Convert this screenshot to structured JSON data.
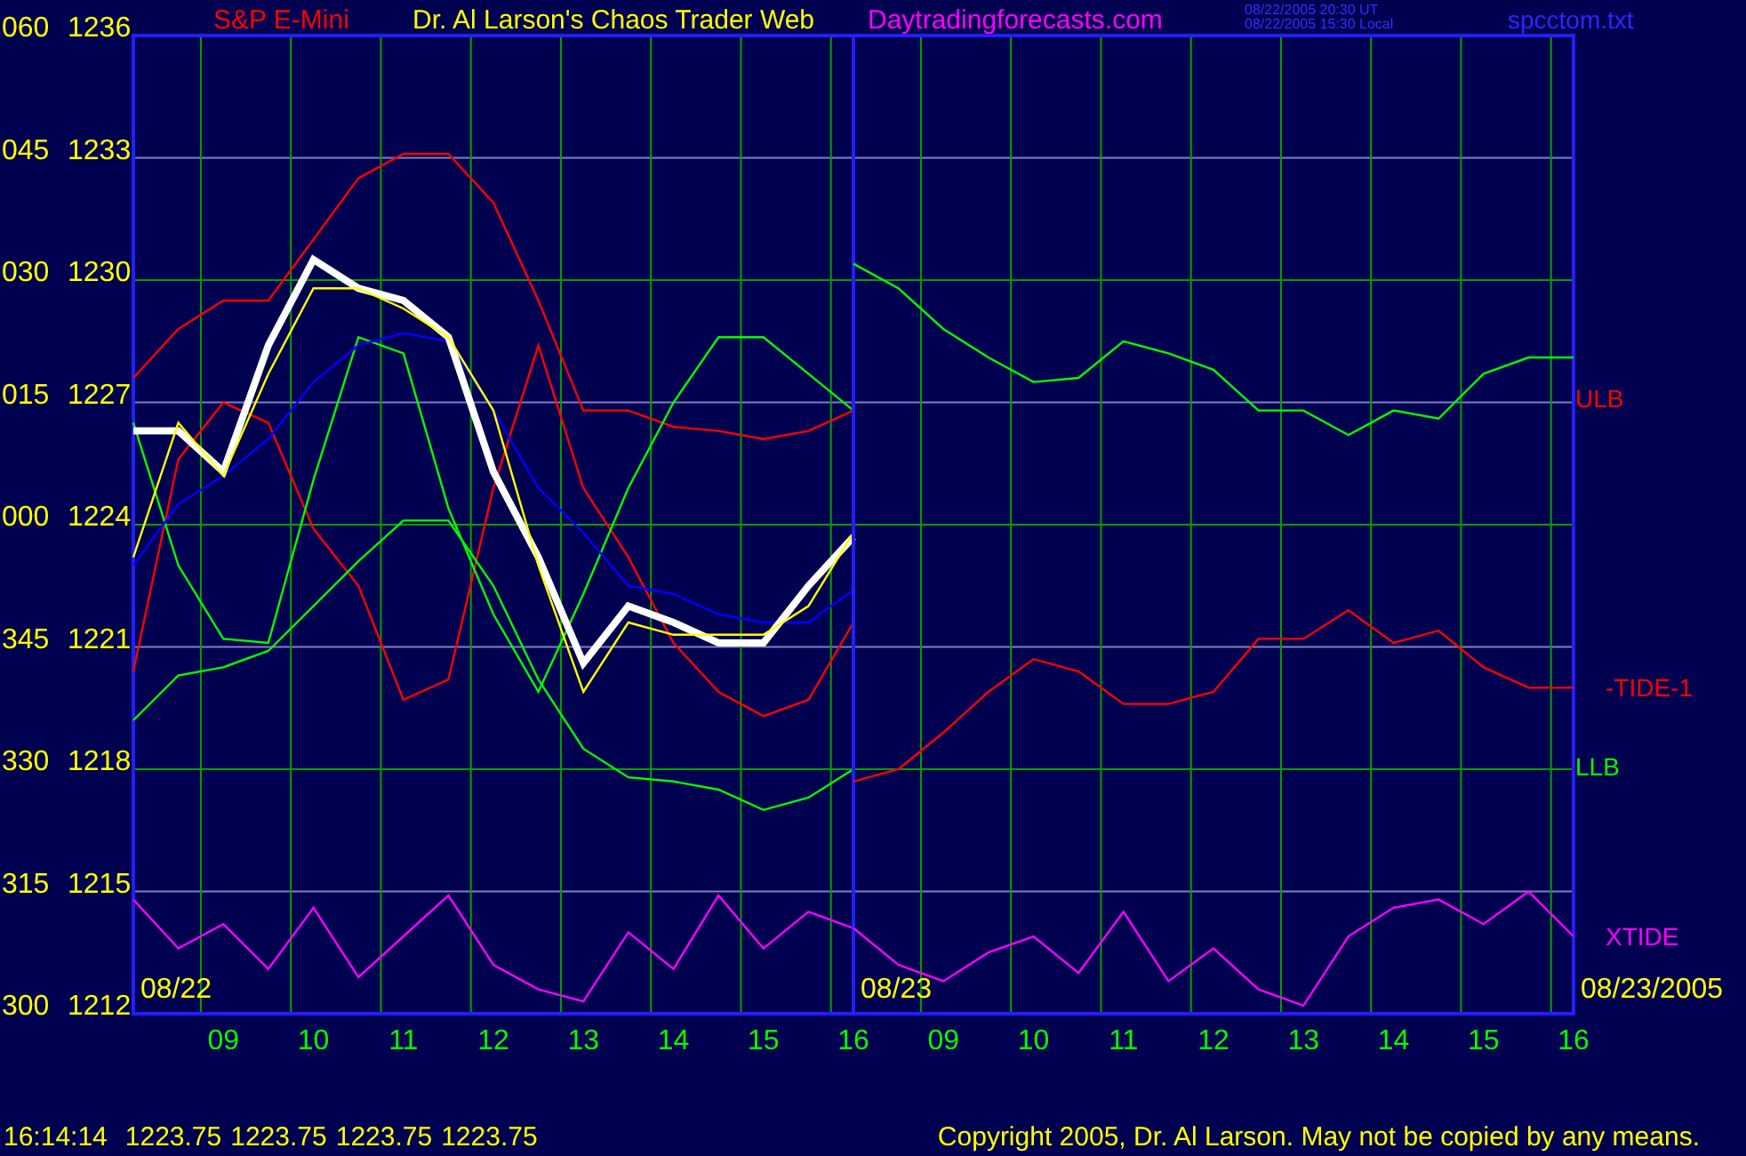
{
  "header": {
    "instrument": "S&P E-Mini",
    "title": "Dr. Al Larson's Chaos Trader Web",
    "site": "Daytradingforecasts.com",
    "timestamps": [
      "08/22/2005 20:30 UT",
      "08/22/2005 15:30 Local"
    ],
    "file": "spcctom.txt"
  },
  "degree_labels": [
    "060",
    "045",
    "030",
    "015",
    "000",
    "345",
    "330",
    "315",
    "300"
  ],
  "band_labels": [
    {
      "text": "ULB",
      "color": "#ff0000"
    },
    {
      "text": "LLB",
      "color": "#00ff00"
    }
  ],
  "end_date": "08/23/2005",
  "charts": [
    {
      "date_label": "08/22",
      "chart_data": {
        "type": "line",
        "grid": true,
        "xlim": [
          8,
          16
        ],
        "ylim": [
          1212,
          1236
        ],
        "x": [
          8,
          8.5,
          9,
          9.5,
          10,
          10.5,
          11,
          11.5,
          12,
          12.5,
          13,
          13.5,
          14,
          14.5,
          15,
          15.5,
          16
        ],
        "xticks": [
          {
            "value": 9,
            "label": "09"
          },
          {
            "value": 10,
            "label": "10"
          },
          {
            "value": 11,
            "label": "11"
          },
          {
            "value": 12,
            "label": "12"
          },
          {
            "value": 13,
            "label": "13"
          },
          {
            "value": 14,
            "label": "14"
          },
          {
            "value": 15,
            "label": "15"
          },
          {
            "value": 16,
            "label": "16"
          }
        ],
        "yticks": [
          1212,
          1215,
          1218,
          1221,
          1224,
          1227,
          1230,
          1233,
          1236
        ],
        "series": [
          {
            "color": "#ff0000",
            "values": [
              1220.4,
              1225.6,
              1227.0,
              1226.5,
              1223.9,
              1222.5,
              1219.7,
              1220.2,
              1224.9,
              1228.4,
              1224.9,
              1223.2,
              1221.1,
              1219.9,
              1219.3,
              1219.7,
              1221.6
            ]
          },
          {
            "color": "#ff0000",
            "values": [
              1227.6,
              1228.8,
              1229.5,
              1229.5,
              1231.0,
              1232.5,
              1233.1,
              1233.1,
              1231.9,
              1229.5,
              1226.8,
              1226.8,
              1226.4,
              1226.3,
              1226.1,
              1226.3,
              1226.8
            ]
          },
          {
            "color": "#00ff00",
            "values": [
              1226.5,
              1223.0,
              1221.2,
              1221.1,
              1225.1,
              1228.6,
              1228.2,
              1224.4,
              1221.8,
              1219.9,
              1222.3,
              1224.9,
              1227.0,
              1228.6,
              1228.6,
              1227.7,
              1226.8
            ]
          },
          {
            "color": "#00ff00",
            "values": [
              1219.2,
              1220.3,
              1220.5,
              1220.9,
              1222.0,
              1223.1,
              1224.1,
              1224.1,
              1222.5,
              1220.2,
              1218.5,
              1217.8,
              1217.7,
              1217.5,
              1217.0,
              1217.3,
              1218.0
            ]
          },
          {
            "color": "#0000ff",
            "values": [
              1223.0,
              1224.5,
              1225.2,
              1226.1,
              1227.5,
              1228.4,
              1228.7,
              1228.5,
              1226.8,
              1224.9,
              1223.8,
              1222.5,
              1222.3,
              1221.8,
              1221.6,
              1221.6,
              1222.4
            ]
          },
          {
            "color": "#ff00ff",
            "values": [
              1214.8,
              1213.6,
              1214.2,
              1213.1,
              1214.6,
              1212.9,
              1213.9,
              1214.9,
              1213.2,
              1212.6,
              1212.3,
              1214.0,
              1213.1,
              1214.9,
              1213.6,
              1214.5,
              1214.1
            ]
          },
          {
            "color": "#ffffff",
            "values": [
              1226.3,
              1226.3,
              1225.3,
              1228.4,
              1230.5,
              1229.8,
              1229.5,
              1228.6,
              1225.3,
              1223.2,
              1220.6,
              1222.0,
              1221.6,
              1221.1,
              1221.1,
              1222.5,
              1223.7
            ]
          },
          {
            "color": "#ffff00",
            "values": [
              1223.2,
              1226.5,
              1225.2,
              1227.7,
              1229.8,
              1229.8,
              1229.3,
              1228.6,
              1226.8,
              1223.0,
              1219.9,
              1221.6,
              1221.3,
              1221.3,
              1221.3,
              1222.0,
              1223.8
            ]
          }
        ]
      }
    },
    {
      "date_label": "08/23",
      "chart_data": {
        "type": "line",
        "grid": true,
        "xlim": [
          8,
          16
        ],
        "ylim": [
          1212,
          1236
        ],
        "x": [
          8,
          8.5,
          9,
          9.5,
          10,
          10.5,
          11,
          11.5,
          12,
          12.5,
          13,
          13.5,
          14,
          14.5,
          15,
          15.5,
          16
        ],
        "xticks": [
          {
            "value": 9,
            "label": "09"
          },
          {
            "value": 10,
            "label": "10"
          },
          {
            "value": 11,
            "label": "11"
          },
          {
            "value": 12,
            "label": "12"
          },
          {
            "value": 13,
            "label": "13"
          },
          {
            "value": 14,
            "label": "14"
          },
          {
            "value": 15,
            "label": "15"
          },
          {
            "value": 16,
            "label": "16"
          }
        ],
        "series": [
          {
            "color": "#00ff00",
            "values": [
              1230.4,
              1229.8,
              1228.8,
              1228.1,
              1227.5,
              1227.6,
              1228.5,
              1228.2,
              1227.8,
              1226.8,
              1226.8,
              1226.2,
              1226.8,
              1226.6,
              1227.7,
              1228.1,
              1228.1
            ]
          },
          {
            "name": "-TIDE-1",
            "color": "#ff0000",
            "values": [
              1217.7,
              1218.0,
              1218.9,
              1219.9,
              1220.7,
              1220.4,
              1219.6,
              1219.6,
              1219.9,
              1221.2,
              1221.2,
              1221.9,
              1221.1,
              1221.4,
              1220.5,
              1220.0,
              1220.0
            ]
          },
          {
            "name": "XTIDE",
            "color": "#ff00ff",
            "values": [
              1214.1,
              1213.2,
              1212.8,
              1213.5,
              1213.9,
              1213.0,
              1214.5,
              1212.8,
              1213.6,
              1212.6,
              1212.2,
              1213.9,
              1214.6,
              1214.8,
              1214.2,
              1215.0,
              1213.9
            ]
          }
        ]
      }
    }
  ],
  "status_bar": {
    "time": "16:14:14",
    "quotes": [
      "1223.75",
      "1223.75",
      "1223.75",
      "1223.75"
    ],
    "copyright": "Copyright 2005, Dr. Al Larson. May not be copied by any means."
  }
}
